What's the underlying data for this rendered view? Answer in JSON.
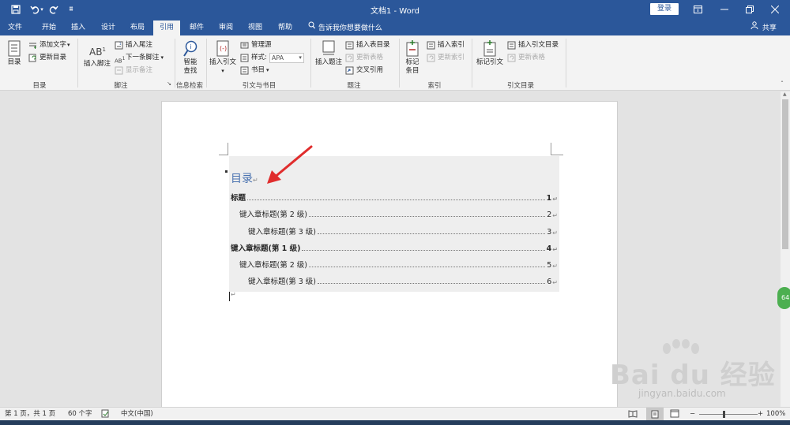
{
  "titlebar": {
    "title": "文档1 - Word",
    "login_label": "登录",
    "icons": [
      "save-icon",
      "undo-icon",
      "redo-icon",
      "customize-qat-icon"
    ]
  },
  "tabs": [
    {
      "label": "文件"
    },
    {
      "label": "开始"
    },
    {
      "label": "插入"
    },
    {
      "label": "设计"
    },
    {
      "label": "布局"
    },
    {
      "label": "引用",
      "active": true
    },
    {
      "label": "邮件"
    },
    {
      "label": "审阅"
    },
    {
      "label": "视图"
    },
    {
      "label": "帮助"
    }
  ],
  "tellme": "告诉我你想要做什么",
  "share_label": "共享",
  "ribbon": {
    "toc_group": {
      "big_label": "目录",
      "add_text": "添加文字",
      "update_toc": "更新目录",
      "group_label": "目录"
    },
    "footnote_group": {
      "insert_footnote": "插入脚注",
      "insert_endnote": "插入尾注",
      "next_footnote": "下一条脚注",
      "show_notes": "显示备注",
      "group_label": "脚注"
    },
    "research_group": {
      "smart_lookup_1": "智能",
      "smart_lookup_2": "查找",
      "group_label": "信息检索"
    },
    "citation_group": {
      "insert_citation": "插入引文",
      "manage_sources": "管理源",
      "style_label": "样式:",
      "style_value": "APA",
      "bibliography": "书目",
      "group_label": "引文与书目"
    },
    "caption_group": {
      "insert_caption": "插入题注",
      "insert_tof": "插入表目录",
      "update_table": "更新表格",
      "cross_ref": "交叉引用",
      "group_label": "题注"
    },
    "index_group": {
      "mark_entry_1": "标记",
      "mark_entry_2": "条目",
      "insert_index": "插入索引",
      "update_index": "更新索引",
      "group_label": "索引"
    },
    "toa_group": {
      "mark_citation": "标记引文",
      "insert_toa": "插入引文目录",
      "update_toa": "更新表格",
      "group_label": "引文目录"
    }
  },
  "document": {
    "toc_heading": "目录",
    "toc_entries": [
      {
        "text": "标题",
        "page": "1",
        "level": 1
      },
      {
        "text": "键入章标题(第 2 级)",
        "page": "2",
        "level": 2
      },
      {
        "text": "键入章标题(第 3 级)",
        "page": "3",
        "level": 3
      },
      {
        "text": "键入章标题(第 1 级)",
        "page": "4",
        "level": 1
      },
      {
        "text": "键入章标题(第 2 级)",
        "page": "5",
        "level": 2
      },
      {
        "text": "键入章标题(第 3 级)",
        "page": "6",
        "level": 3
      }
    ]
  },
  "statusbar": {
    "page_info": "第 1 页，共 1 页",
    "word_count": "60 个字",
    "language": "中文(中国)",
    "zoom": "100%"
  },
  "side_badge": "64",
  "watermark": {
    "main": "Bai du 经验",
    "sub": "jingyan.baidu.com"
  },
  "colors": {
    "titlebar": "#2b579a",
    "ribbon": "#f3f3f3",
    "toc_heading": "#4a72b0",
    "annotation_arrow": "#e02d2d"
  }
}
